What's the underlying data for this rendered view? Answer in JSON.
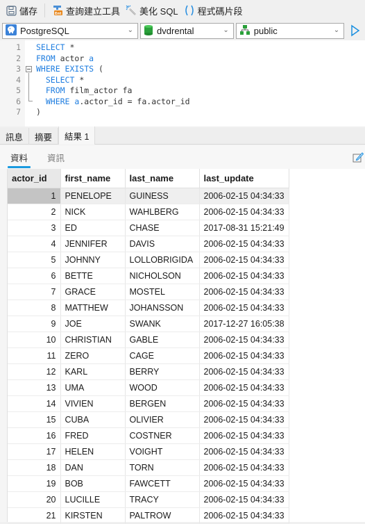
{
  "toolbar": {
    "save": {
      "label": "儲存",
      "icon": "save-icon"
    },
    "query_builder": {
      "label": "查詢建立工具",
      "icon": "query-builder-icon"
    },
    "beautify": {
      "label": "美化 SQL",
      "icon": "magic-wand-icon"
    },
    "snippet": {
      "label": "程式碼片段",
      "icon": "parentheses-icon"
    }
  },
  "selectors": {
    "connection": {
      "value": "PostgreSQL",
      "icon": "postgresql-elephant-icon"
    },
    "database": {
      "value": "dvdrental",
      "icon": "database-icon"
    },
    "schema": {
      "value": "public",
      "icon": "schema-icon"
    },
    "run_icon": "run-play-icon"
  },
  "editor": {
    "lines": [
      {
        "n": "1",
        "parts": [
          {
            "t": "SELECT",
            "k": 1
          },
          {
            "t": " *",
            "k": 0
          }
        ]
      },
      {
        "n": "2",
        "parts": [
          {
            "t": "FROM",
            "k": 1
          },
          {
            "t": " actor ",
            "k": 0
          },
          {
            "t": "a",
            "k": 1
          }
        ]
      },
      {
        "n": "3",
        "parts": [
          {
            "t": "WHERE EXISTS",
            "k": 1
          },
          {
            "t": " (",
            "k": 0
          }
        ]
      },
      {
        "n": "4",
        "parts": [
          {
            "t": "  SELECT",
            "k": 1
          },
          {
            "t": " *",
            "k": 0
          }
        ]
      },
      {
        "n": "5",
        "parts": [
          {
            "t": "  FROM",
            "k": 1
          },
          {
            "t": " film_actor fa",
            "k": 0
          }
        ]
      },
      {
        "n": "6",
        "parts": [
          {
            "t": "  WHERE",
            "k": 1
          },
          {
            "t": " ",
            "k": 0
          },
          {
            "t": "a",
            "k": 1
          },
          {
            "t": ".actor_id = fa.actor_id",
            "k": 0
          }
        ]
      },
      {
        "n": "7",
        "parts": [
          {
            "t": ")",
            "k": 0
          }
        ]
      }
    ]
  },
  "result_tabs": [
    {
      "label": "訊息",
      "active": false
    },
    {
      "label": "摘要",
      "active": false
    },
    {
      "label": "結果 1",
      "active": true
    }
  ],
  "sub_tabs": [
    {
      "label": "資料",
      "active": true
    },
    {
      "label": "資訊",
      "active": false
    }
  ],
  "grid": {
    "columns": [
      "actor_id",
      "first_name",
      "last_name",
      "last_update"
    ],
    "selected_row": 0,
    "rows": [
      [
        "1",
        "PENELOPE",
        "GUINESS",
        "2006-02-15 04:34:33"
      ],
      [
        "2",
        "NICK",
        "WAHLBERG",
        "2006-02-15 04:34:33"
      ],
      [
        "3",
        "ED",
        "CHASE",
        "2017-08-31 15:21:49"
      ],
      [
        "4",
        "JENNIFER",
        "DAVIS",
        "2006-02-15 04:34:33"
      ],
      [
        "5",
        "JOHNNY",
        "LOLLOBRIGIDA",
        "2006-02-15 04:34:33"
      ],
      [
        "6",
        "BETTE",
        "NICHOLSON",
        "2006-02-15 04:34:33"
      ],
      [
        "7",
        "GRACE",
        "MOSTEL",
        "2006-02-15 04:34:33"
      ],
      [
        "8",
        "MATTHEW",
        "JOHANSSON",
        "2006-02-15 04:34:33"
      ],
      [
        "9",
        "JOE",
        "SWANK",
        "2017-12-27 16:05:38"
      ],
      [
        "10",
        "CHRISTIAN",
        "GABLE",
        "2006-02-15 04:34:33"
      ],
      [
        "11",
        "ZERO",
        "CAGE",
        "2006-02-15 04:34:33"
      ],
      [
        "12",
        "KARL",
        "BERRY",
        "2006-02-15 04:34:33"
      ],
      [
        "13",
        "UMA",
        "WOOD",
        "2006-02-15 04:34:33"
      ],
      [
        "14",
        "VIVIEN",
        "BERGEN",
        "2006-02-15 04:34:33"
      ],
      [
        "15",
        "CUBA",
        "OLIVIER",
        "2006-02-15 04:34:33"
      ],
      [
        "16",
        "FRED",
        "COSTNER",
        "2006-02-15 04:34:33"
      ],
      [
        "17",
        "HELEN",
        "VOIGHT",
        "2006-02-15 04:34:33"
      ],
      [
        "18",
        "DAN",
        "TORN",
        "2006-02-15 04:34:33"
      ],
      [
        "19",
        "BOB",
        "FAWCETT",
        "2006-02-15 04:34:33"
      ],
      [
        "20",
        "LUCILLE",
        "TRACY",
        "2006-02-15 04:34:33"
      ],
      [
        "21",
        "KIRSTEN",
        "PALTROW",
        "2006-02-15 04:34:33"
      ]
    ]
  },
  "colors": {
    "keyword": "#1e7de0",
    "accent": "#1a9ae0",
    "run": "#1a8fe0",
    "selected_id_cell": "#c4c4c4"
  }
}
